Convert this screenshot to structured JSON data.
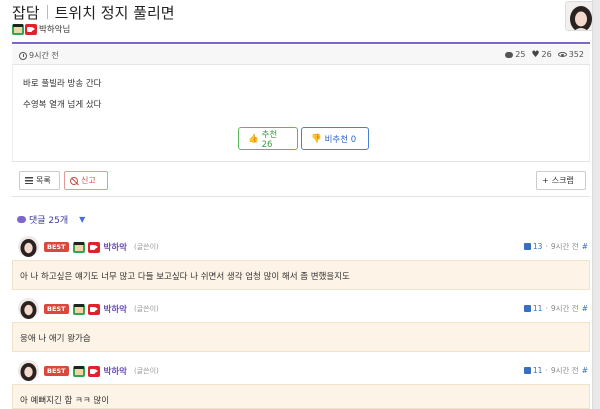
{
  "post": {
    "category": "잡담",
    "title": "트위치 정지 풀리면",
    "author": "박하악님",
    "time": "9시간 전",
    "stats": {
      "comments": "25",
      "likes": "26",
      "views": "352"
    },
    "body": [
      "바로 풀빌라 방송 간다",
      "수영복 열개 넘게 샀다"
    ],
    "upvote_label": "추천 26",
    "downvote_label": "비추천 0"
  },
  "actions": {
    "list_label": "목록",
    "report_label": "신고",
    "scrap_label": "스크랩"
  },
  "comments_header": {
    "label": "댓글 25개"
  },
  "comments": [
    {
      "badge": "BEST",
      "name": "박하악",
      "role": "(글쓴이)",
      "likes": "13",
      "time": "9시간 전",
      "link": "#",
      "text": "아 나 하고싶은 얘기도 너무 많고 다들 보고싶다 나 쉬면서 생각 엄청 많이 해서 좀 변했을지도"
    },
    {
      "badge": "BEST",
      "name": "박하악",
      "role": "(글쓴이)",
      "likes": "11",
      "time": "9시간 전",
      "link": "#",
      "text": "웅애 나 애기 왕가슴"
    },
    {
      "badge": "BEST",
      "name": "박하악",
      "role": "(글쓴이)",
      "likes": "11",
      "time": "9시간 전",
      "link": "#",
      "text": "아 예뻐지긴 함 ㅋㅋ 많이"
    }
  ],
  "colors": {
    "accent": "#7b68c9",
    "best_badge": "#d9483b",
    "comment_bg": "#fdf3e6",
    "upvote": "#5cb85c",
    "downvote": "#4a7fd0"
  },
  "icons": [
    "level-icon",
    "live-camera-icon",
    "clock-icon",
    "comment-icon",
    "heart-icon",
    "eye-icon",
    "thumbs-up-icon",
    "thumbs-down-icon",
    "list-icon",
    "report-icon",
    "plus-icon",
    "chat-bubble-icon",
    "caret-down-icon"
  ]
}
